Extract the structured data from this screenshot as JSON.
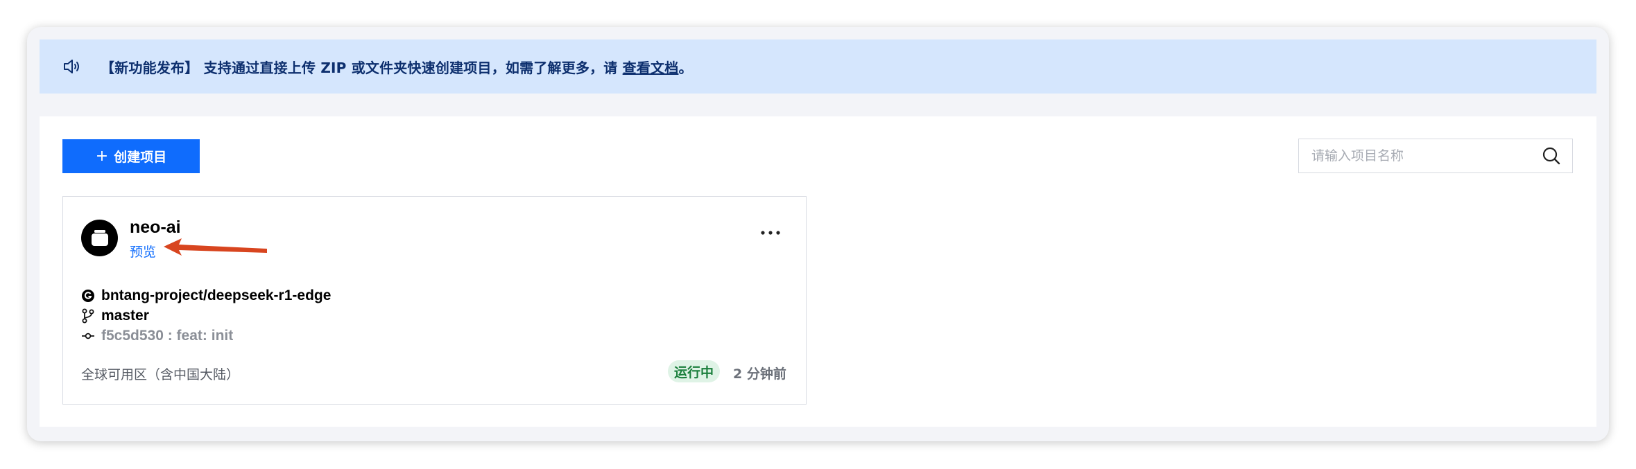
{
  "notice": {
    "icon": "speaker-icon",
    "text": "【新功能发布】 支持通过直接上传 ZIP 或文件夹快速创建项目，如需了解更多，请 ",
    "link_text": "查看文档",
    "suffix": "。"
  },
  "toolbar": {
    "create_label": "创建项目",
    "create_icon": "plus-icon",
    "search_placeholder": "请输入项目名称",
    "search_icon": "search-icon"
  },
  "project": {
    "name": "neo-ai",
    "preview_label": "预览",
    "more_icon": "more-icon",
    "repo": "bntang-project/deepseek-r1-edge",
    "branch": "master",
    "commit": "f5c5d530 : feat: init",
    "region": "全球可用区（含中国大陆）",
    "status": "运行中",
    "updated": "2 分钟前"
  },
  "colors": {
    "accent": "#0f6cfd",
    "notice_bg": "#d5e6fd",
    "status_bg": "#dff3e6",
    "status_text": "#1a7f3c",
    "annotation_arrow": "#d8451f"
  }
}
